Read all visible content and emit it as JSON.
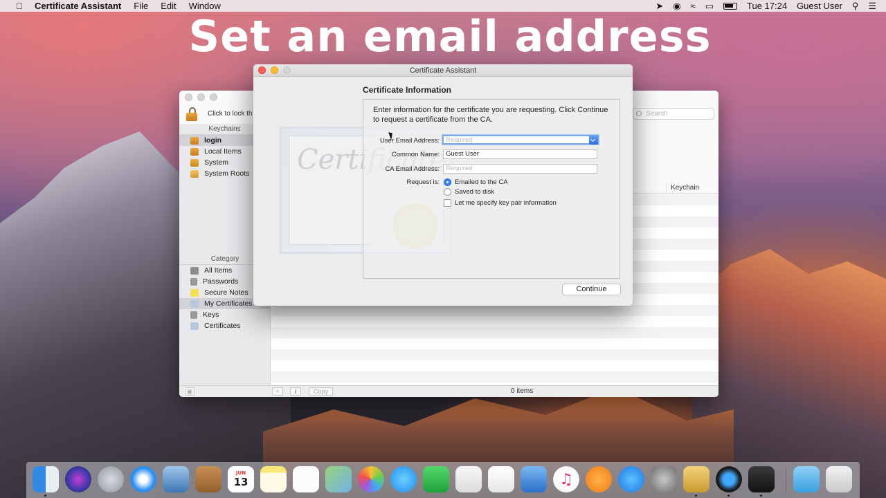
{
  "menubar": {
    "app_name": "Certificate Assistant",
    "menus": [
      "File",
      "Edit",
      "Window"
    ],
    "clock": "Tue 17:24",
    "user": "Guest User"
  },
  "headline": "Set an email address",
  "keychain_window": {
    "lock_label": "Click to lock th",
    "search_placeholder": "Search",
    "keychains_header": "Keychains",
    "keychains": [
      {
        "label": "login",
        "icon": "lock-open-icon"
      },
      {
        "label": "Local Items",
        "icon": "lock-open-icon"
      },
      {
        "label": "System",
        "icon": "lock-icon"
      },
      {
        "label": "System Roots",
        "icon": "cabinet-icon"
      }
    ],
    "category_header": "Category",
    "categories": [
      {
        "label": "All Items",
        "icon": "all-items-icon"
      },
      {
        "label": "Passwords",
        "icon": "key-icon"
      },
      {
        "label": "Secure Notes",
        "icon": "note-icon"
      },
      {
        "label": "My Certificates",
        "icon": "my-certificates-icon"
      },
      {
        "label": "Keys",
        "icon": "key-icon"
      },
      {
        "label": "Certificates",
        "icon": "certificate-icon"
      }
    ],
    "column_keychain": "Keychain",
    "copy_button": "Copy",
    "items_count": "0 items"
  },
  "certificate_assistant": {
    "title": "Certificate Assistant",
    "heading": "Certificate Information",
    "intro": "Enter information for the certificate you are requesting. Click Continue to request a certificate from the CA.",
    "art_text": "Certificate",
    "fields": {
      "user_email_label": "User Email Address:",
      "user_email_placeholder": "Required",
      "user_email_value": "",
      "common_name_label": "Common Name:",
      "common_name_value": "Guest User",
      "ca_email_label": "CA Email Address:",
      "ca_email_placeholder": "Required",
      "request_label": "Request is:",
      "option_emailed": "Emailed to the CA",
      "option_saved": "Saved to disk",
      "option_keypair": "Let me specify key pair information",
      "selected_option": "Emailed to the CA"
    },
    "continue_button": "Continue"
  },
  "dock": {
    "calendar_day": "13",
    "calendar_month": "JUN",
    "apps": [
      "finder",
      "siri",
      "launchpad",
      "safari",
      "mail",
      "contacts",
      "calendar",
      "notes",
      "reminders",
      "maps",
      "photos",
      "messages",
      "facetime",
      "pages",
      "numbers",
      "keynote",
      "itunes",
      "ibooks",
      "app-store",
      "system-preferences",
      "keychain-access",
      "quicktime",
      "bartender",
      "downloads",
      "trash"
    ]
  }
}
